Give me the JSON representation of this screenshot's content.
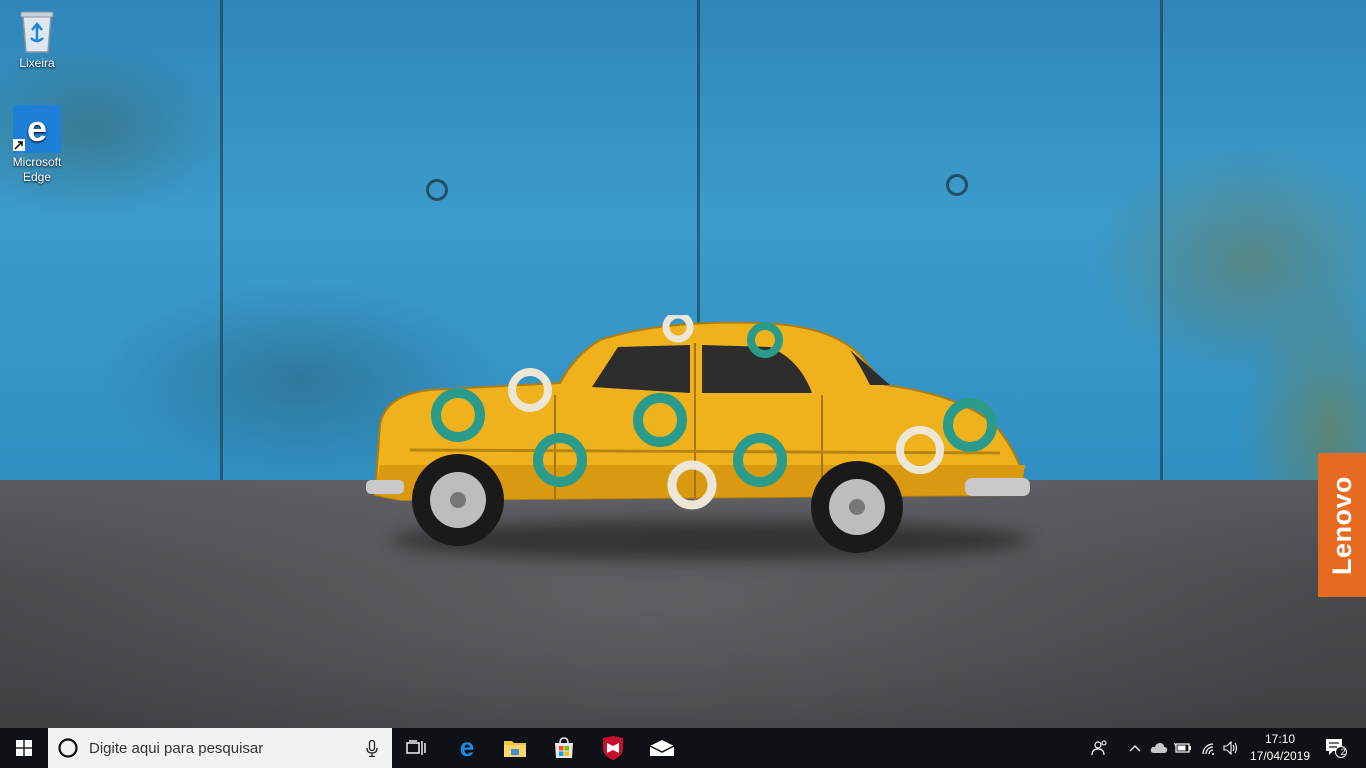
{
  "desktop": {
    "icons": [
      {
        "label": "Lixeira",
        "icon": "recycle-bin-icon"
      },
      {
        "label": "Microsoft\nEdge",
        "icon": "edge-icon"
      }
    ],
    "wallpaper_brand": "Lenovo"
  },
  "taskbar": {
    "start_icon": "windows-logo-icon",
    "search": {
      "placeholder": "Digite aqui para pesquisar"
    },
    "pinned_apps": [
      {
        "name": "task-view",
        "icon": "task-view-icon"
      },
      {
        "name": "edge",
        "icon": "edge-icon"
      },
      {
        "name": "file-explorer",
        "icon": "folder-icon"
      },
      {
        "name": "store",
        "icon": "store-icon"
      },
      {
        "name": "mcafee",
        "icon": "mcafee-icon"
      },
      {
        "name": "mail",
        "icon": "mail-icon"
      }
    ],
    "tray": {
      "time": "17:10",
      "date": "17/04/2019",
      "notification_count": "2"
    },
    "colors": {
      "background": "#0e1216",
      "accent": "#0078d7"
    }
  }
}
